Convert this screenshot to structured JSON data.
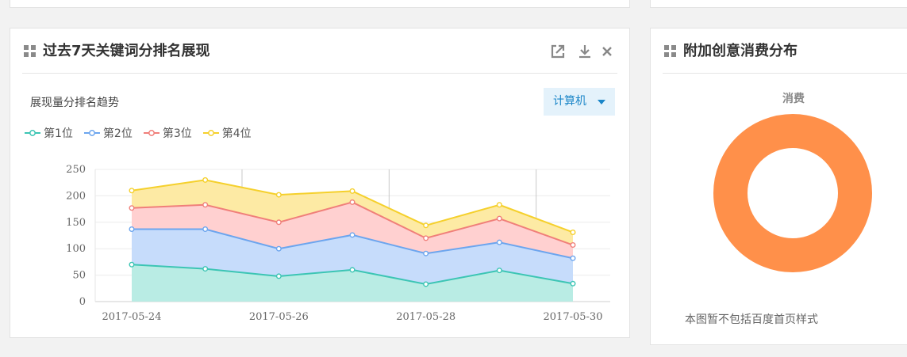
{
  "left_card": {
    "title": "过去7天关键词分排名展现",
    "icons": [
      "external-link-icon",
      "download-icon",
      "close-icon"
    ],
    "subtitle": "展现量分排名趋势",
    "device_select": "计算机"
  },
  "right_card": {
    "title": "附加创意消费分布",
    "footnote": "本图暂不包括百度首页样式"
  },
  "colors": {
    "series": [
      "#3cc5b4",
      "#6ca5ee",
      "#f07f7a",
      "#f5d02c"
    ],
    "fills": [
      "#b9ece4",
      "#c6dcfb",
      "#ffd0d0",
      "#fdeaa4"
    ],
    "donut": "#ff904a"
  },
  "chart_data": [
    {
      "type": "area",
      "stacked": true,
      "title": "展现量分排名趋势",
      "x": [
        "2017-05-24",
        "2017-05-25",
        "2017-05-26",
        "2017-05-27",
        "2017-05-28",
        "2017-05-29",
        "2017-05-30"
      ],
      "x_tick_labels": [
        "2017-05-24",
        "2017-05-26",
        "2017-05-28",
        "2017-05-30"
      ],
      "y_ticks": [
        0,
        50,
        100,
        150,
        200,
        250
      ],
      "ylim": [
        0,
        250
      ],
      "legend_position": "top-left",
      "series": [
        {
          "name": "第1位",
          "values": [
            70,
            62,
            48,
            60,
            33,
            59,
            34
          ]
        },
        {
          "name": "第2位",
          "values": [
            67,
            75,
            52,
            66,
            58,
            53,
            48
          ]
        },
        {
          "name": "第3位",
          "values": [
            40,
            46,
            50,
            62,
            29,
            45,
            25
          ]
        },
        {
          "name": "第4位",
          "values": [
            33,
            47,
            52,
            21,
            24,
            26,
            24
          ]
        }
      ]
    },
    {
      "type": "pie",
      "donut": true,
      "title": "消费",
      "slices": [
        {
          "name": "",
          "value": 100
        }
      ]
    }
  ]
}
